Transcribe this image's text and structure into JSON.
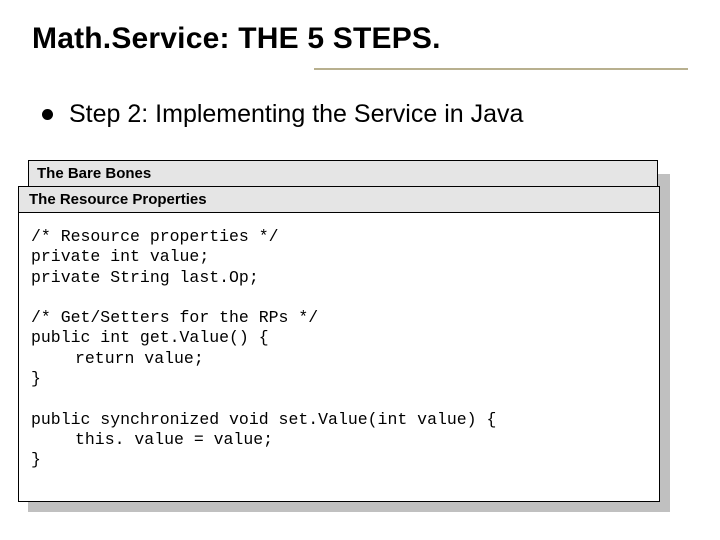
{
  "slide": {
    "title": "Math.Service: THE 5 STEPS.",
    "bullet": "Step 2: Implementing the Service in Java"
  },
  "back_box": {
    "header": "The Bare Bones"
  },
  "front_box": {
    "header": "The Resource Properties",
    "code": {
      "l1": "/* Resource properties */",
      "l2": "private int value;",
      "l3": "private String last.Op;",
      "blank1": " ",
      "l4": "/* Get/Setters for the RPs */",
      "l5": "public int get.Value() {",
      "l6": "return value;",
      "l7": "}",
      "blank2": " ",
      "l8": "public synchronized void set.Value(int value) {",
      "l9": "this. value = value;",
      "l10": "}"
    }
  }
}
